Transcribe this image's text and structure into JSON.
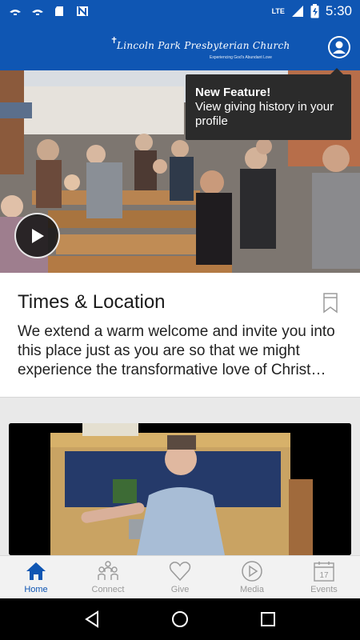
{
  "status_bar": {
    "icons_left": [
      "notification-icon",
      "notification-icon",
      "sd-card-icon",
      "n-app-icon"
    ],
    "network": "LTE",
    "time": "5:30"
  },
  "header": {
    "logo_text": "Lincoln Park Presbyterian Church",
    "logo_tagline": "Experiencing God's Abundant Love",
    "profile_icon": "person-icon"
  },
  "tooltip": {
    "title": "New Feature!",
    "body": "View giving history in your profile"
  },
  "hero": {
    "play_icon": "play-icon"
  },
  "times_card": {
    "title": "Times & Location",
    "description": "We extend a warm welcome and invite you into this place just as you are so that we might experience the transformative love of Christ together.",
    "bookmark_icon": "bookmark-icon"
  },
  "bottom_nav": {
    "items": [
      {
        "label": "Home",
        "icon": "home-icon",
        "active": true
      },
      {
        "label": "Connect",
        "icon": "people-icon",
        "active": false
      },
      {
        "label": "Give",
        "icon": "heart-icon",
        "active": false
      },
      {
        "label": "Media",
        "icon": "play-circle-icon",
        "active": false
      },
      {
        "label": "Events",
        "icon": "calendar-icon",
        "active": false
      }
    ],
    "events_day": "17"
  },
  "colors": {
    "primary": "#0f56b3",
    "tooltip_bg": "#2b2b2b",
    "inactive_nav": "#9a9a9a"
  }
}
